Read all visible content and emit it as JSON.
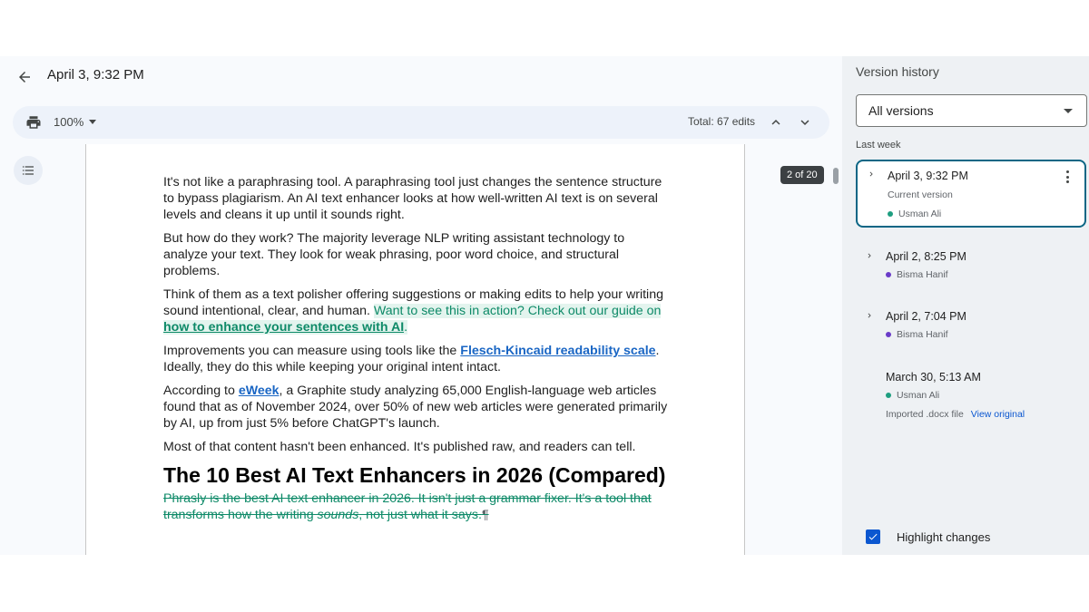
{
  "header": {
    "title": "April 3, 9:32 PM"
  },
  "toolbar": {
    "zoom": "100%",
    "total_edits": "Total: 67 edits"
  },
  "document": {
    "page_counter": "2 of 20",
    "para1": "It's not like a paraphrasing tool. A paraphrasing tool just changes the sentence structure to bypass plagiarism. An AI text enhancer looks at how well-written AI text is on several levels and cleans it up until it sounds right.",
    "para2": "But how do they work? The majority leverage NLP writing assistant technology to analyze your text. They look for weak phrasing, poor word choice, and structural problems.",
    "para3_plain": "Think of them as a text polisher offering suggestions or making edits to help your writing sound intentional, clear, and human.",
    "para3_added": "Want to see this in action? Check out our guide on",
    "para3_added_link": "how to enhance your sentences with AI",
    "para3_added_end": ".",
    "para4_start": "Improvements you can measure using tools like the",
    "para4_link": "Flesch-Kincaid readability scale",
    "para4_end": ". Ideally, they do this while keeping your original intent intact.",
    "para5_start": "According to",
    "para5_link": "eWeek",
    "para5_end": ", a Graphite study analyzing 65,000 English-language web articles found that as of November 2024, over 50% of new web articles were generated primarily by AI, up from just 5% before ChatGPT's launch.",
    "para6": "Most of that content hasn't been enhanced. It's published raw, and readers can tell.",
    "heading": "The 10 Best AI Text Enhancers in 2026 (Compared)",
    "deleted_start": "Phrasly is the best AI text enhancer in 2026. It isn't just a grammar fixer. It's a tool that transforms how the writing",
    "deleted_italic": "sounds",
    "deleted_end": ", not just what it says.",
    "pilcrow": "¶"
  },
  "version_history": {
    "title": "Version history",
    "filter": "All versions",
    "group_label": "Last week",
    "versions": [
      {
        "date": "April 3, 9:32 PM",
        "note": "Current version",
        "author": "Usman Ali",
        "author_color": "#1e9e80"
      },
      {
        "date": "April 2, 8:25 PM",
        "author": "Bisma Hanif",
        "author_color": "#6a3cc8"
      },
      {
        "date": "April 2, 7:04 PM",
        "author": "Bisma Hanif",
        "author_color": "#6a3cc8"
      },
      {
        "date": "March 30, 5:13 AM",
        "author": "Usman Ali",
        "author_color": "#1e9e80",
        "note": "Imported .docx file",
        "action": "View original"
      }
    ],
    "highlight_changes": "Highlight changes",
    "highlight_checked": true
  },
  "icons": [
    "arrow-back-icon",
    "print-icon",
    "chevron-up-icon",
    "chevron-down-icon",
    "outline-icon",
    "chevron-right-icon",
    "more-vert-icon",
    "checkmark-icon"
  ]
}
